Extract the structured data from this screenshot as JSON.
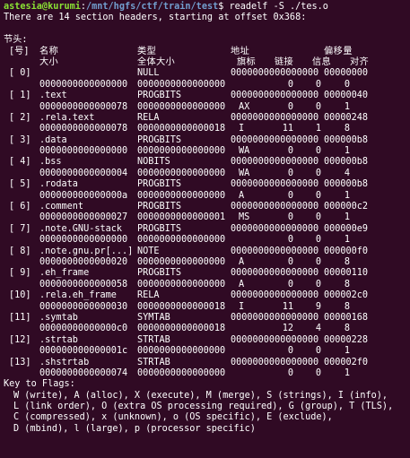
{
  "prompt": {
    "user_host": "astesia@kurumi",
    "colon": ":",
    "path": "/mnt/hgfs/ctf/train/test",
    "symbol": "$ ",
    "command": "readelf -S ./tes.o"
  },
  "intro": "There are 14 section headers, starting at offset 0x368:",
  "section_label": "节头:",
  "headers": {
    "row1": {
      "idx": "[号]",
      "name": "名称",
      "type": "类型",
      "addr": "地址",
      "off": "偏移量"
    },
    "row2": {
      "size": "大小",
      "esize": "全体大小",
      "flags": "旗标",
      "link": "链接",
      "info": "信息",
      "align": "对齐"
    }
  },
  "sections": [
    {
      "idx": "[ 0]",
      "name": "",
      "type": "NULL",
      "addr": "0000000000000000",
      "off": "00000000",
      "size": "0000000000000000",
      "esize": "0000000000000000",
      "flags": "",
      "link": "0",
      "info": "0",
      "align": "0"
    },
    {
      "idx": "[ 1]",
      "name": ".text",
      "type": "PROGBITS",
      "addr": "0000000000000000",
      "off": "00000040",
      "size": "0000000000000078",
      "esize": "0000000000000000",
      "flags": "AX",
      "link": "0",
      "info": "0",
      "align": "1"
    },
    {
      "idx": "[ 2]",
      "name": ".rela.text",
      "type": "RELA",
      "addr": "0000000000000000",
      "off": "00000248",
      "size": "0000000000000078",
      "esize": "0000000000000018",
      "flags": "I",
      "link": "11",
      "info": "1",
      "align": "8"
    },
    {
      "idx": "[ 3]",
      "name": ".data",
      "type": "PROGBITS",
      "addr": "0000000000000000",
      "off": "000000b8",
      "size": "0000000000000000",
      "esize": "0000000000000000",
      "flags": "WA",
      "link": "0",
      "info": "0",
      "align": "1"
    },
    {
      "idx": "[ 4]",
      "name": ".bss",
      "type": "NOBITS",
      "addr": "0000000000000000",
      "off": "000000b8",
      "size": "0000000000000004",
      "esize": "0000000000000000",
      "flags": "WA",
      "link": "0",
      "info": "0",
      "align": "4"
    },
    {
      "idx": "[ 5]",
      "name": ".rodata",
      "type": "PROGBITS",
      "addr": "0000000000000000",
      "off": "000000b8",
      "size": "000000000000000a",
      "esize": "0000000000000000",
      "flags": "A",
      "link": "0",
      "info": "0",
      "align": "1"
    },
    {
      "idx": "[ 6]",
      "name": ".comment",
      "type": "PROGBITS",
      "addr": "0000000000000000",
      "off": "000000c2",
      "size": "0000000000000027",
      "esize": "0000000000000001",
      "flags": "MS",
      "link": "0",
      "info": "0",
      "align": "1"
    },
    {
      "idx": "[ 7]",
      "name": ".note.GNU-stack",
      "type": "PROGBITS",
      "addr": "0000000000000000",
      "off": "000000e9",
      "size": "0000000000000000",
      "esize": "0000000000000000",
      "flags": "",
      "link": "0",
      "info": "0",
      "align": "1"
    },
    {
      "idx": "[ 8]",
      "name": ".note.gnu.pr[...]",
      "type": "NOTE",
      "addr": "0000000000000000",
      "off": "000000f0",
      "size": "0000000000000020",
      "esize": "0000000000000000",
      "flags": "A",
      "link": "0",
      "info": "0",
      "align": "8"
    },
    {
      "idx": "[ 9]",
      "name": ".eh_frame",
      "type": "PROGBITS",
      "addr": "0000000000000000",
      "off": "00000110",
      "size": "0000000000000058",
      "esize": "0000000000000000",
      "flags": "A",
      "link": "0",
      "info": "0",
      "align": "8"
    },
    {
      "idx": "[10]",
      "name": ".rela.eh_frame",
      "type": "RELA",
      "addr": "0000000000000000",
      "off": "000002c0",
      "size": "0000000000000030",
      "esize": "0000000000000018",
      "flags": "I",
      "link": "11",
      "info": "9",
      "align": "8"
    },
    {
      "idx": "[11]",
      "name": ".symtab",
      "type": "SYMTAB",
      "addr": "0000000000000000",
      "off": "00000168",
      "size": "00000000000000c0",
      "esize": "0000000000000018",
      "flags": "",
      "link": "12",
      "info": "4",
      "align": "8"
    },
    {
      "idx": "[12]",
      "name": ".strtab",
      "type": "STRTAB",
      "addr": "0000000000000000",
      "off": "00000228",
      "size": "000000000000001c",
      "esize": "0000000000000000",
      "flags": "",
      "link": "0",
      "info": "0",
      "align": "1"
    },
    {
      "idx": "[13]",
      "name": ".shstrtab",
      "type": "STRTAB",
      "addr": "0000000000000000",
      "off": "000002f0",
      "size": "0000000000000074",
      "esize": "0000000000000000",
      "flags": "",
      "link": "0",
      "info": "0",
      "align": "1"
    }
  ],
  "key": {
    "title": "Key to Flags:",
    "lines": [
      "W (write), A (alloc), X (execute), M (merge), S (strings), I (info),",
      "L (link order), O (extra OS processing required), G (group), T (TLS),",
      "C (compressed), x (unknown), o (OS specific), E (exclude),",
      "D (mbind), l (large), p (processor specific)"
    ]
  }
}
